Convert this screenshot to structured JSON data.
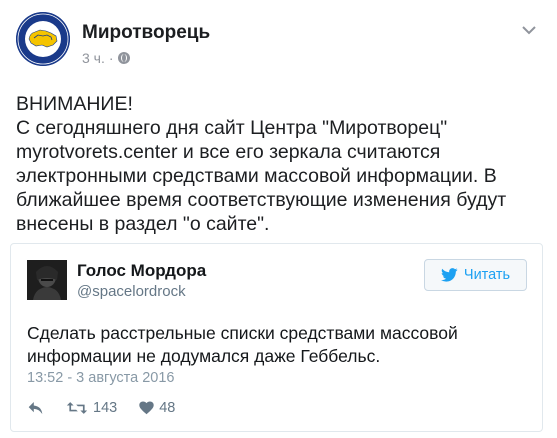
{
  "post": {
    "page_name": "Миротворець",
    "time": "3 ч.",
    "separator": "·",
    "text": "ВНИМАНИЕ!\nС сегодняшнего дня сайт Центра \"Миротворец\"\nmyrotvorets.center и все его зеркала считаются\nэлектронными средствами массовой информации. В\nближайшее время соответствующие изменения будут\nвнесены в раздел \"о сайте\".",
    "avatar_logo": {
      "top_text": "МИРОТВОРЕЦЬ",
      "bottom_text": "PRO BONO PUBLICO"
    },
    "icons": {
      "privacy": "globe-icon",
      "menu": "chevron-down-icon"
    }
  },
  "tweet": {
    "name": "Голос Мордора",
    "handle": "@spacelordrock",
    "follow_label": "Читать",
    "text": "Сделать расстрельные списки средствами массовой информации не додумался даже Геббельс.",
    "date": "13:52 - 3 августа 2016",
    "retweets": "143",
    "likes": "48",
    "icons": {
      "follow": "twitter-bird-icon",
      "reply": "reply-icon",
      "retweet": "retweet-icon",
      "like": "heart-icon"
    },
    "colors": {
      "accent": "#1da1f2",
      "border": "#e1e8ed",
      "muted": "#657786"
    }
  }
}
